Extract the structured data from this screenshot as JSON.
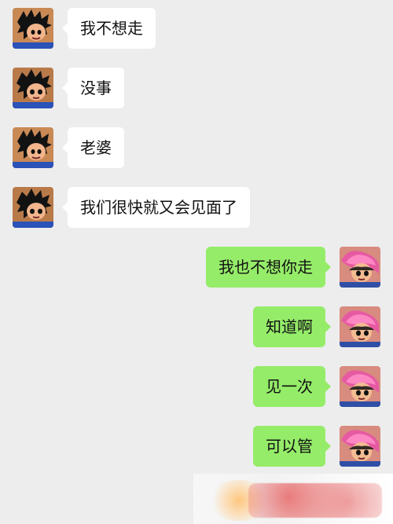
{
  "messages": [
    {
      "side": "left",
      "text": "我不想走"
    },
    {
      "side": "left",
      "text": "没事"
    },
    {
      "side": "left",
      "text": "老婆"
    },
    {
      "side": "left",
      "text": "我们很快就又会见面了"
    },
    {
      "side": "right",
      "text": "我也不想你走"
    },
    {
      "side": "right",
      "text": "知道啊"
    },
    {
      "side": "right",
      "text": "见一次"
    },
    {
      "side": "right",
      "text": "可以管"
    }
  ],
  "colors": {
    "background": "#ededed",
    "incoming_bubble": "#ffffff",
    "outgoing_bubble": "#95ec69"
  },
  "avatars": {
    "left": "anime-boy-avatar",
    "right": "anime-girl-avatar"
  },
  "watermark": {
    "icon": "watermark-logo"
  }
}
